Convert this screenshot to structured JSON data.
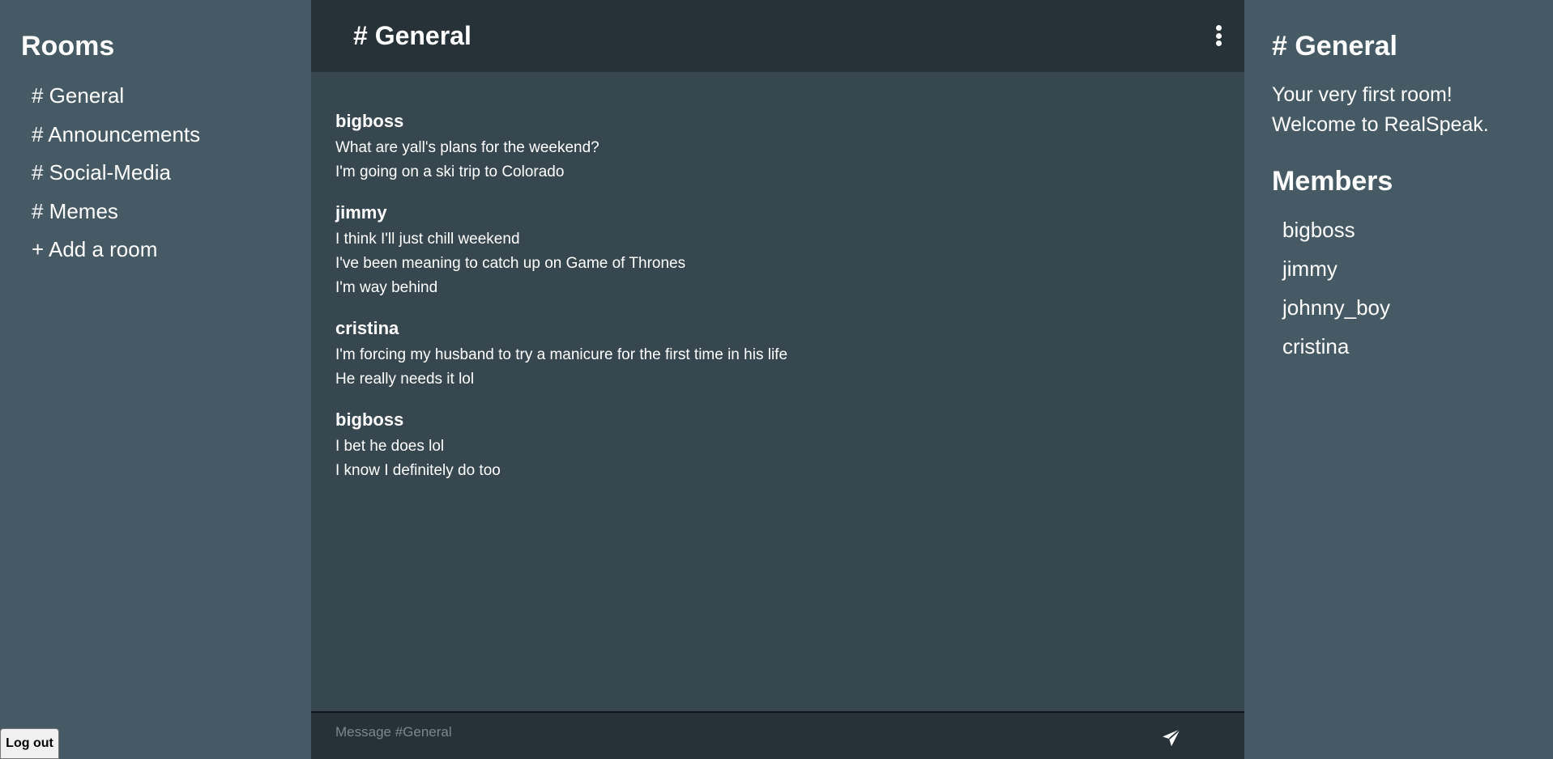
{
  "rooms_panel": {
    "title": "Rooms",
    "items": [
      {
        "label": "# General"
      },
      {
        "label": "# Announcements"
      },
      {
        "label": "# Social-Media"
      },
      {
        "label": "# Memes"
      }
    ],
    "add_room_label": "+ Add a room",
    "logout_label": "Log out"
  },
  "header": {
    "title": "# General",
    "menu_icon": "kebab-menu-icon"
  },
  "messages": [
    {
      "author": "bigboss",
      "lines": [
        "What are yall's plans for the weekend?",
        "I'm going on a ski trip to Colorado"
      ]
    },
    {
      "author": "jimmy",
      "lines": [
        "I think I'll just chill weekend",
        "I've been meaning to catch up on Game of Thrones",
        "I'm way behind"
      ]
    },
    {
      "author": "cristina",
      "lines": [
        "I'm forcing my husband to try a manicure for the first time in his life",
        "He really needs it lol"
      ]
    },
    {
      "author": "bigboss",
      "lines": [
        "I bet he does lol",
        "I know I definitely do too"
      ]
    }
  ],
  "composer": {
    "placeholder": "Message #General",
    "send_icon": "send-icon"
  },
  "room_info": {
    "title": "# General",
    "description_line1": "Your very first room!",
    "description_line2": "Welcome to RealSpeak.",
    "members_title": "Members",
    "members": [
      "bigboss",
      "jimmy",
      "johnny_boy",
      "cristina"
    ]
  },
  "colors": {
    "sidebar_bg": "#455a64",
    "main_bg": "#37474f",
    "header_bg": "#263238"
  }
}
